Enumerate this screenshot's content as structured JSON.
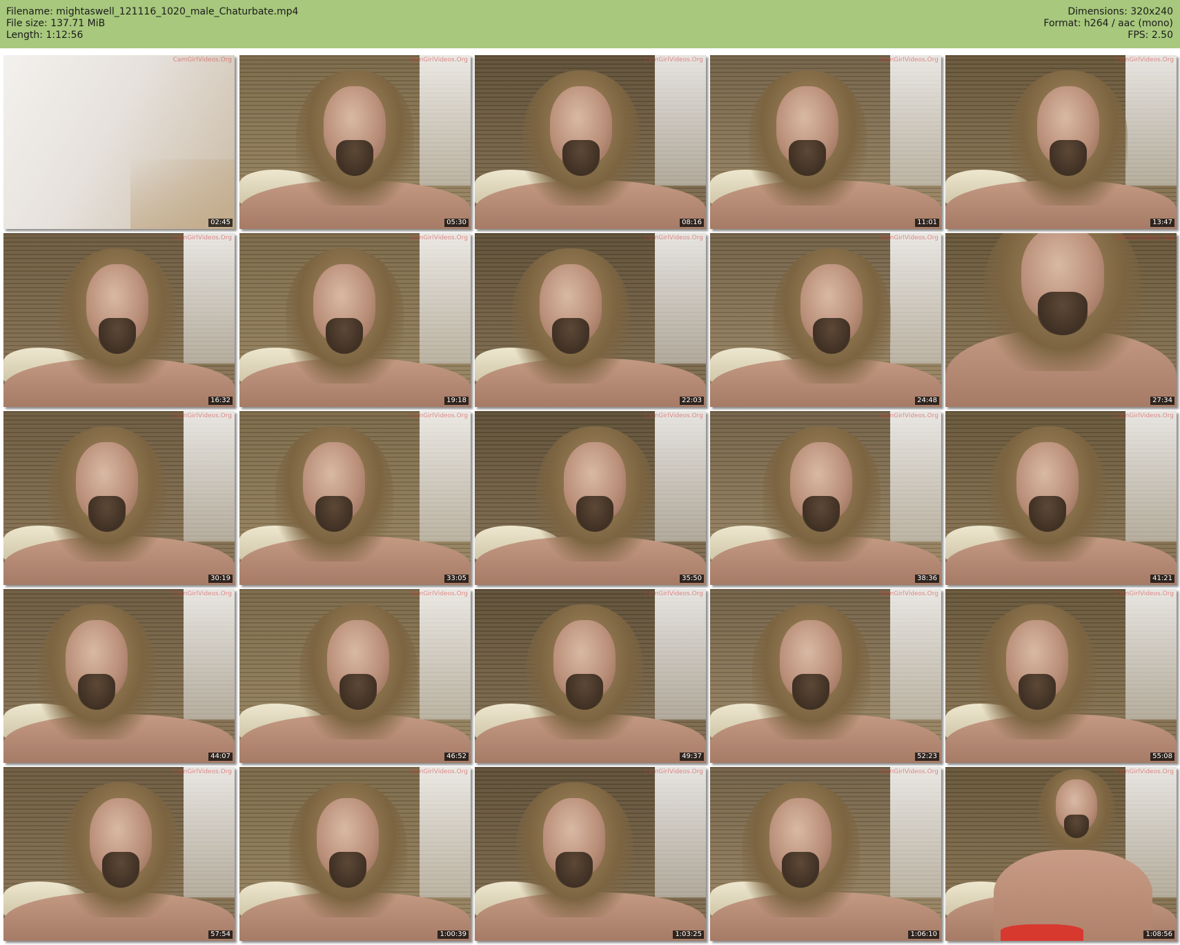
{
  "header": {
    "filename": "Filename: mightaswell_121116_1020_male_Chaturbate.mp4",
    "filesize": "File size: 137.71 MiB",
    "length": "Length: 1:12:56",
    "dimensions": "Dimensions: 320x240",
    "format": "Format: h264 / aac (mono)",
    "fps": "FPS: 2.50"
  },
  "watermark": "CamGirlVideos.Org",
  "colors": {
    "header_bg": "#a8c87d",
    "timestamp_bg": "#000000",
    "timestamp_text": "#ffffff"
  },
  "thumbnails": [
    {
      "time": "02:45",
      "scene": "blurry"
    },
    {
      "time": "05:30",
      "scene": "face"
    },
    {
      "time": "08:16",
      "scene": "face"
    },
    {
      "time": "11:01",
      "scene": "face"
    },
    {
      "time": "13:47",
      "scene": "face"
    },
    {
      "time": "16:32",
      "scene": "face"
    },
    {
      "time": "19:18",
      "scene": "face"
    },
    {
      "time": "22:03",
      "scene": "face"
    },
    {
      "time": "24:48",
      "scene": "face"
    },
    {
      "time": "27:34",
      "scene": "closeup"
    },
    {
      "time": "30:19",
      "scene": "face"
    },
    {
      "time": "33:05",
      "scene": "face"
    },
    {
      "time": "35:50",
      "scene": "face"
    },
    {
      "time": "38:36",
      "scene": "face"
    },
    {
      "time": "41:21",
      "scene": "face"
    },
    {
      "time": "44:07",
      "scene": "face"
    },
    {
      "time": "46:52",
      "scene": "face"
    },
    {
      "time": "49:37",
      "scene": "face"
    },
    {
      "time": "52:23",
      "scene": "face"
    },
    {
      "time": "55:08",
      "scene": "face"
    },
    {
      "time": "57:54",
      "scene": "face"
    },
    {
      "time": "1:00:39",
      "scene": "face"
    },
    {
      "time": "1:03:25",
      "scene": "face"
    },
    {
      "time": "1:06:10",
      "scene": "face"
    },
    {
      "time": "1:08:56",
      "scene": "wide"
    }
  ]
}
